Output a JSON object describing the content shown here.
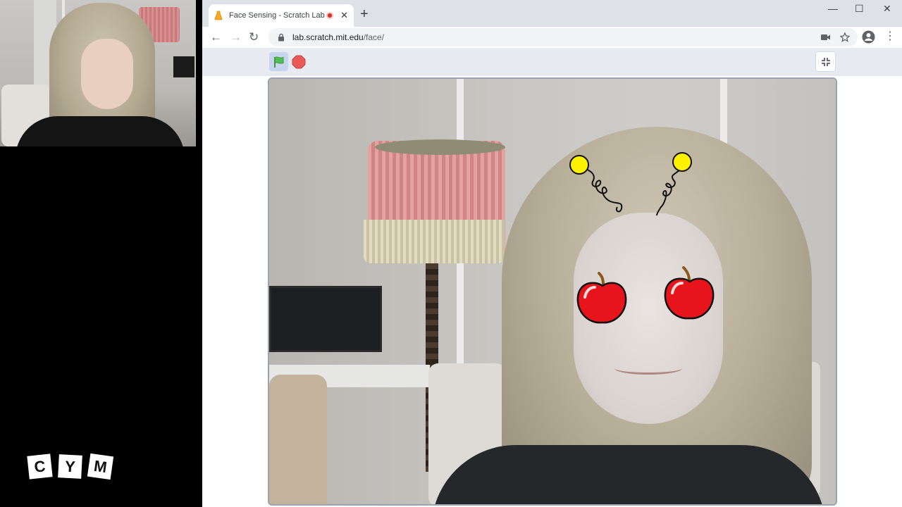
{
  "branding": {
    "logo_letters": [
      "C",
      "Y",
      "M"
    ]
  },
  "browser": {
    "tab": {
      "title": "Face Sensing - Scratch Lab",
      "favicon": "scratch-lab-icon",
      "recording": true
    },
    "new_tab_label": "+",
    "window_controls": {
      "minimize": "—",
      "maximize": "☐",
      "close": "✕"
    },
    "nav": {
      "back": "←",
      "forward": "→",
      "reload": "↻"
    },
    "address": {
      "host": "lab.scratch.mit.edu",
      "path": "/face/"
    },
    "omnibox_icons": [
      "lock-icon",
      "camera-icon",
      "star-icon"
    ],
    "menu_label": "⋮"
  },
  "scratch": {
    "controls": [
      "green-flag-icon",
      "stop-icon"
    ],
    "fullscreen": "exit-fullscreen-icon",
    "stage_sprites": [
      "antenna-left",
      "antenna-right",
      "apple-left",
      "apple-right"
    ]
  },
  "colors": {
    "tabbar_bg": "#dee1e6",
    "scratch_bar_bg": "#e7ebf1",
    "flag_green": "#4cbf56",
    "stop_red": "#ec5959",
    "apple_red": "#e8141b",
    "antenna_yellow": "#fff200"
  }
}
